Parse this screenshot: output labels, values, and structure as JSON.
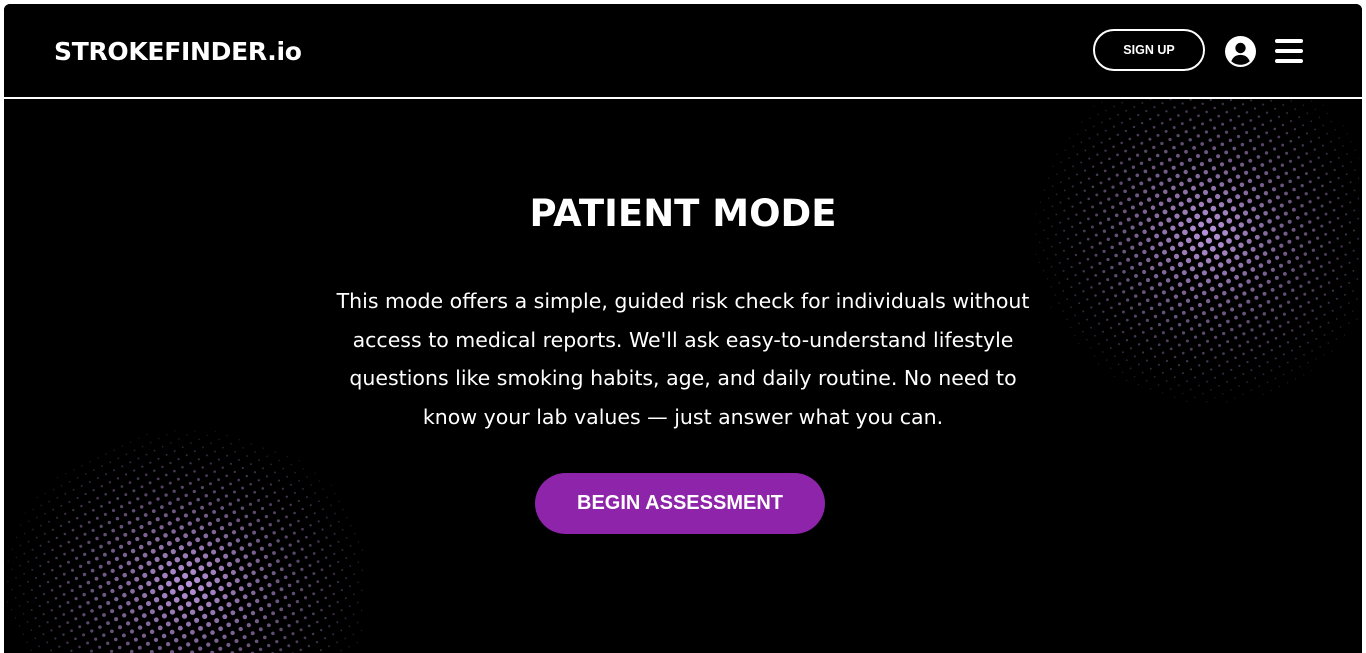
{
  "brand": {
    "name": "STROKEFINDER.io"
  },
  "header": {
    "signup_label": "SIGN UP",
    "user_icon": "user-circle-icon",
    "menu_icon": "hamburger-menu-icon"
  },
  "hero": {
    "title": "PATIENT MODE",
    "description": "This mode offers a simple, guided risk check for individuals without access to medical reports. We'll ask easy-to-understand lifestyle questions like smoking habits, age, and daily routine. No need to know your lab values — just answer what you can.",
    "cta_label": "BEGIN ASSESSMENT"
  },
  "colors": {
    "background": "#000000",
    "text": "#ffffff",
    "accent": "#8e24aa",
    "halftone": "#b892d9"
  }
}
